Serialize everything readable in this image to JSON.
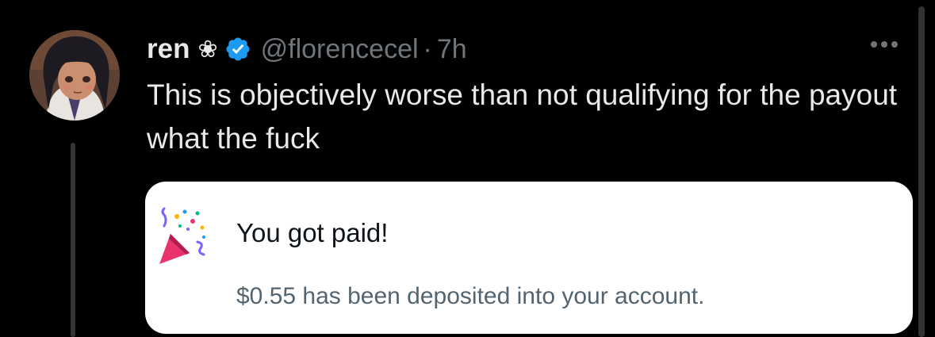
{
  "tweet": {
    "display_name": "ren",
    "name_emoji": "❀",
    "handle": "@florencecel",
    "separator": "·",
    "time": "7h",
    "text": "This is objectively worse than not qualifying for the payout what the fuck",
    "more_icon": "more-horizontal-icon",
    "verified_icon": "verified-badge-icon"
  },
  "card": {
    "icon": "party-popper-icon",
    "title": "You got paid!",
    "body": "$0.55 has been deposited into your account."
  },
  "colors": {
    "background": "#000000",
    "text_primary": "#e7e9ea",
    "text_secondary": "#71767b",
    "verified_blue": "#1d9bf0",
    "card_bg": "#ffffff",
    "card_title": "#0f1419",
    "card_body": "#536471"
  }
}
